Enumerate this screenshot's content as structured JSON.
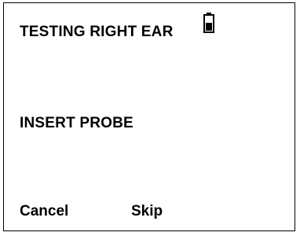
{
  "screen": {
    "title": "TESTING RIGHT EAR",
    "status_icon": "battery-icon",
    "message": "INSERT PROBE"
  },
  "softkeys": {
    "left_label": "Cancel",
    "right_label": "Skip"
  }
}
